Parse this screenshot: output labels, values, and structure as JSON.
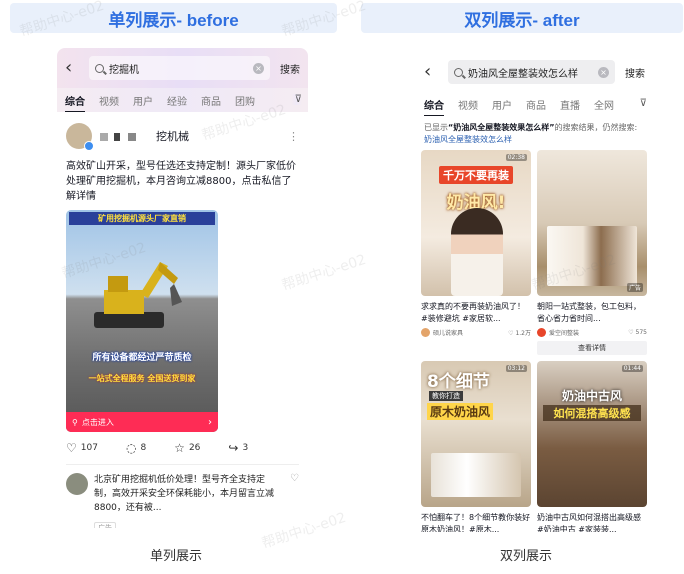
{
  "banners": {
    "left": "单列展示- before",
    "right": "双列展示- after"
  },
  "captions": {
    "left": "单列展示",
    "right": "双列展示"
  },
  "watermark": "帮助中心-e02",
  "single": {
    "search": {
      "query": "挖掘机",
      "button": "搜索"
    },
    "tabs": [
      "综合",
      "视频",
      "用户",
      "经验",
      "商品",
      "团购"
    ],
    "post": {
      "author": "挖机械",
      "text": "高效矿山开采，型号任选还支持定制！源头厂家低价处理矿用挖掘机，本月咨询立减8800，点击私信了解详情",
      "media_headline": "矿用挖掘机源头厂家直销",
      "media_caption1": "所有设备都经过严苛质检",
      "media_caption2": "一站式全程服务 全国送货到家",
      "cta": "点击进入",
      "likes": "107",
      "comments": "8",
      "favorites": "26",
      "shares": "3"
    },
    "ad": {
      "text": "北京矿用挖掘机低价处理！型号齐全支持定制，高效开采安全环保耗能小，本月留言立减8800，还有被...",
      "tag": "广告"
    }
  },
  "double": {
    "search": {
      "query": "奶油风全屋整装效怎么样",
      "button": "搜索"
    },
    "tabs": [
      "综合",
      "视频",
      "用户",
      "商品",
      "直播",
      "全网"
    ],
    "notice": {
      "prefix": "已显示",
      "query": "“奶油风全屋整装效果怎么样”",
      "suffix": "的搜索结果，仍然搜索:",
      "link": "奶油风全屋整装效怎么样"
    },
    "cards": [
      {
        "cover_line1": "千万不要再装",
        "cover_line2": "奶油风!",
        "duration": "02:38",
        "title": "求求真的不要再装奶油风了！#装修避坑 #家居软...",
        "author": "硕儿说家具",
        "likes": "1.2万",
        "author_color": "#e3a46a"
      },
      {
        "ad_label": "广告",
        "title": "朝阳一站式整装，包工包料，省心省力省时间...",
        "author": "爱空间整装",
        "likes": "575",
        "button": "查看详情",
        "author_color": "#e8462a"
      },
      {
        "cover_line1": "8个细节",
        "cover_line2": "教你打造",
        "cover_line3": "原木奶油风",
        "duration": "03:12",
        "title": "不怕翻车了！8个细节教你装好原木奶油风！#原木..."
      },
      {
        "cover_line1": "奶油中古风",
        "cover_line2": "如何混搭高级感",
        "duration": "01:44",
        "title": "奶油中古风如何混搭出高级感#奶油中古 #家装装..."
      }
    ]
  },
  "colors": {
    "accent_blue": "#2f6fe0",
    "cta_red": "#fe2c55",
    "banner_bg": "#e9f0fb"
  }
}
